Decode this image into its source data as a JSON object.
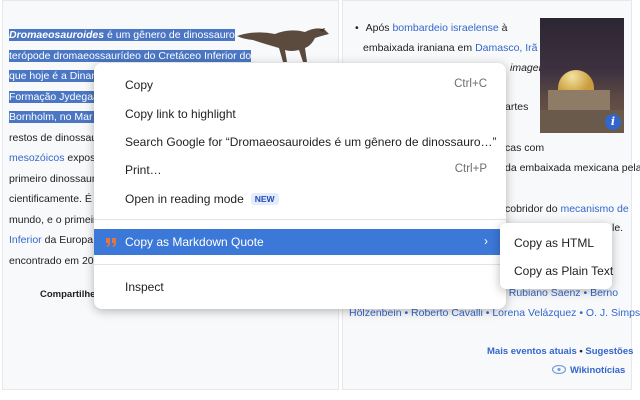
{
  "left_column": {
    "lines": [
      {
        "pre_hl_bold": "Dromaeosauroides",
        "hl": " é um gênero de dinossauro"
      },
      {
        "hl": "terópode dromaeossaurídeo do Cretáceo Inferior do"
      },
      {
        "hl": "que hoje é a Dinama"
      },
      {
        "hl": "Formação Jydegaard"
      },
      {
        "hl": "Bornholm, no Mar Ba"
      },
      {
        "text": "restos de dinossauro"
      },
      {
        "link": "mesozóicos",
        "text": " exposto"
      },
      {
        "text": "primeiro dinossauro"
      },
      {
        "text": "cientificamente. É un"
      },
      {
        "text": "mundo, e o primeiro"
      },
      {
        "link": "Inferior",
        "text": " da Europa. É"
      },
      {
        "text": "encontrado em 2000"
      }
    ],
    "share_label": "Compartilhe:"
  },
  "right_column": {
    "bullet1_pre": "Após ",
    "bullet1_link": "bombardeio israelense",
    "bullet1_post": " à",
    "line2_pre": "embaixada iraniana em ",
    "line2_link": "Damasco, Irã",
    "line3_frag": "imagem)",
    "line4_frag": "artes",
    "line5_frag": "cas com",
    "line6_frag": "da embaixada mexicana pela",
    "line7_pre": "cobridor do ",
    "line7_link": "mecanismo de",
    "line8_frag": "le.",
    "line9_frag": "o Rubiano Saenz • Berno",
    "line10": "Hölzenbein • Roberto Cavalli • Lorena Velázquez • O. J. Simpson",
    "more_events": "Mais eventos atuais",
    "suggestions": "Sugestões",
    "wikinews": "Wikinotícias",
    "info_badge": "i"
  },
  "context_menu": {
    "copy": "Copy",
    "copy_shortcut": "Ctrl+C",
    "copy_link": "Copy link to highlight",
    "search": "Search Google for “Dromaeosauroides é um gênero de dinossauro…”",
    "print": "Print…",
    "print_shortcut": "Ctrl+P",
    "reading_mode": "Open in reading mode",
    "new_badge": "NEW",
    "markdown": "Copy as Markdown Quote",
    "inspect": "Inspect"
  },
  "submenu": {
    "html": "Copy as HTML",
    "plain": "Copy as Plain Text"
  },
  "colors": {
    "selection": "#4a76c4",
    "menu_highlight": "#3c78d8",
    "link": "#3366cc",
    "markdown_icon": "#e8743b"
  }
}
